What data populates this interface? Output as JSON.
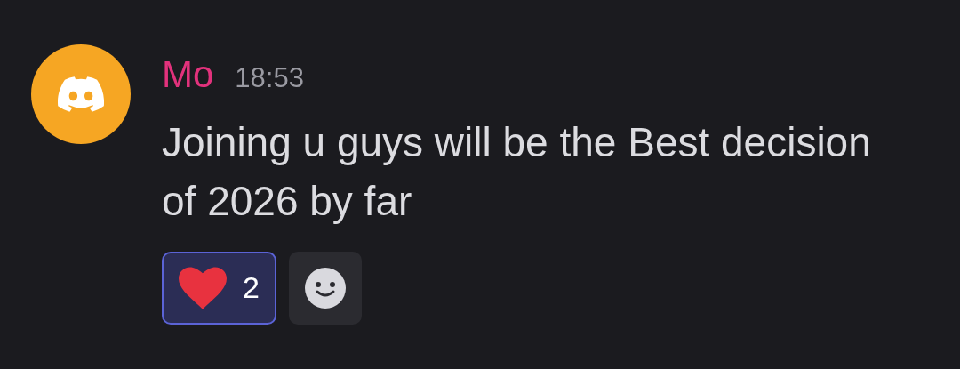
{
  "message": {
    "author": "Mo",
    "time": "18:53",
    "text": "Joining u guys will be the Best decision of 2026 by far"
  },
  "reactions": [
    {
      "count": "2",
      "selected": true
    }
  ]
}
